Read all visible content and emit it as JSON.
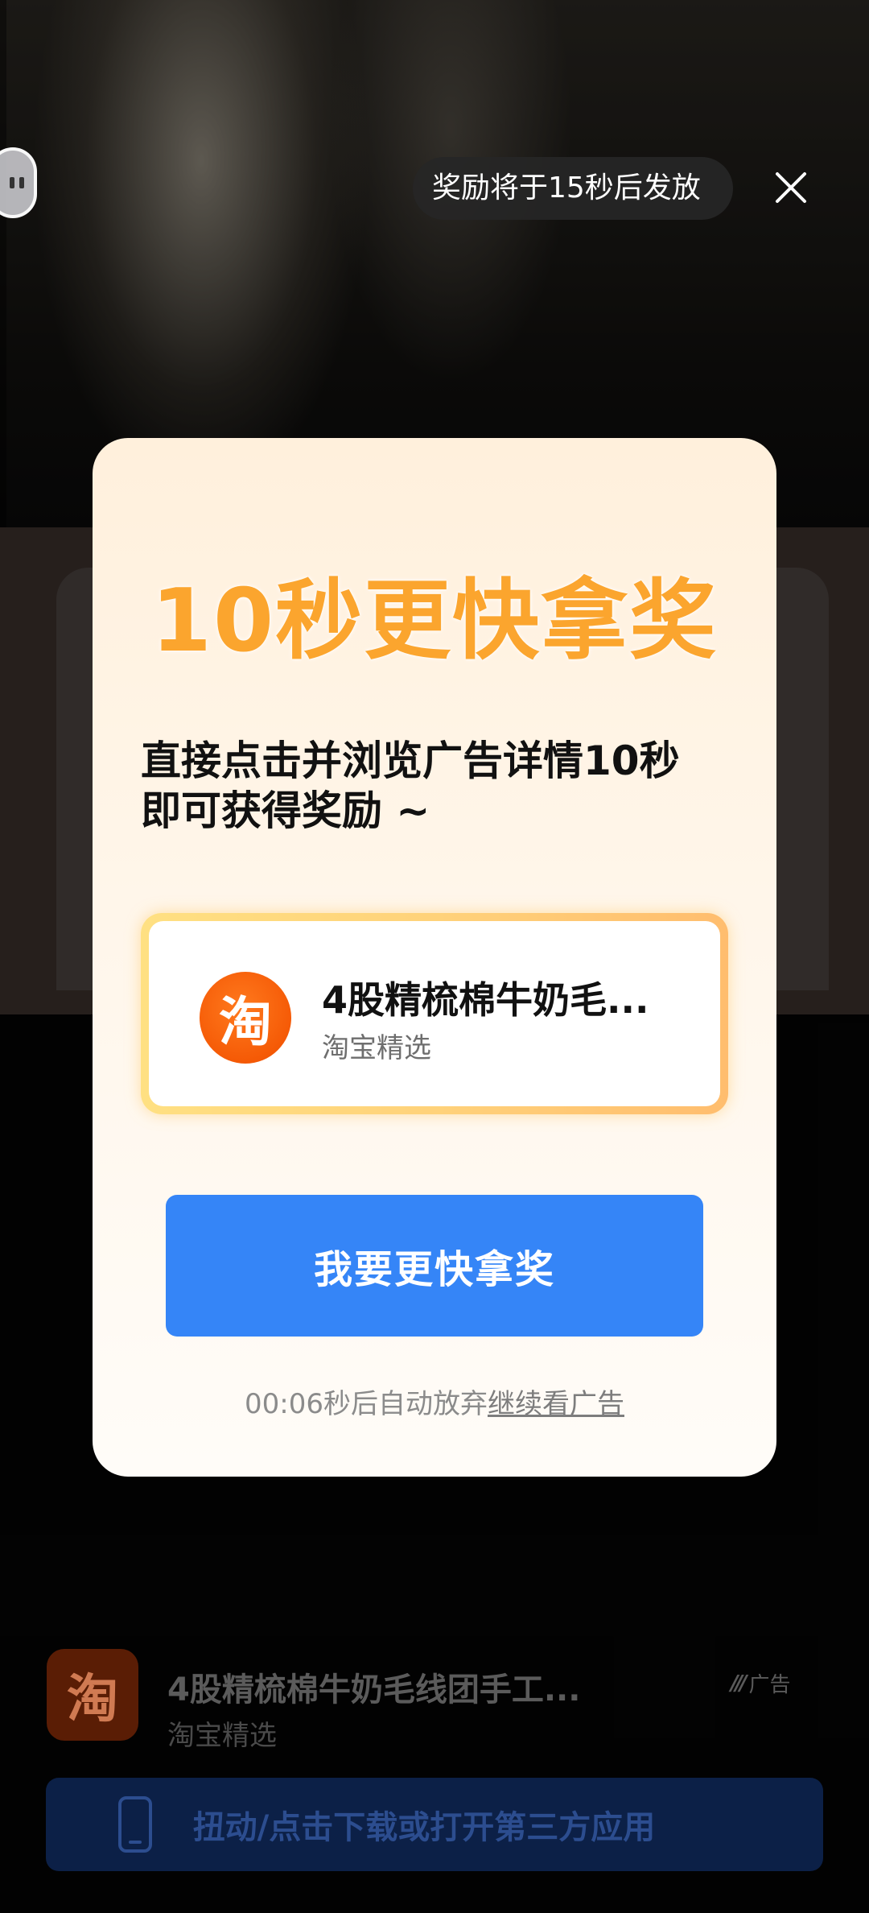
{
  "top_bar": {
    "reward_countdown": "奖励将于15秒后发放",
    "pause_icon": "pause-icon",
    "close_icon": "close-icon"
  },
  "modal": {
    "title": "10秒更快拿奖",
    "description_line1": "直接点击并浏览广告详情10秒",
    "description_line2": "即可获得奖励 ~",
    "product": {
      "name": "4股精梳棉牛奶毛...",
      "shop": "淘宝精选",
      "logo_glyph": "淘"
    },
    "cta_label": "我要更快拿奖",
    "auto_note_prefix": "00:06秒后自动放弃",
    "auto_note_link": "继续看广告"
  },
  "bottom_ad": {
    "logo_glyph": "淘",
    "title": "4股精梳棉牛奶毛线团手工...",
    "shop": "淘宝精选",
    "ad_label": "广告",
    "download_label": "扭动/点击下载或打开第三方应用"
  },
  "colors": {
    "title_orange": "#fba52e",
    "cta_blue": "#3585f7",
    "taobao_orange": "#f55a06"
  }
}
